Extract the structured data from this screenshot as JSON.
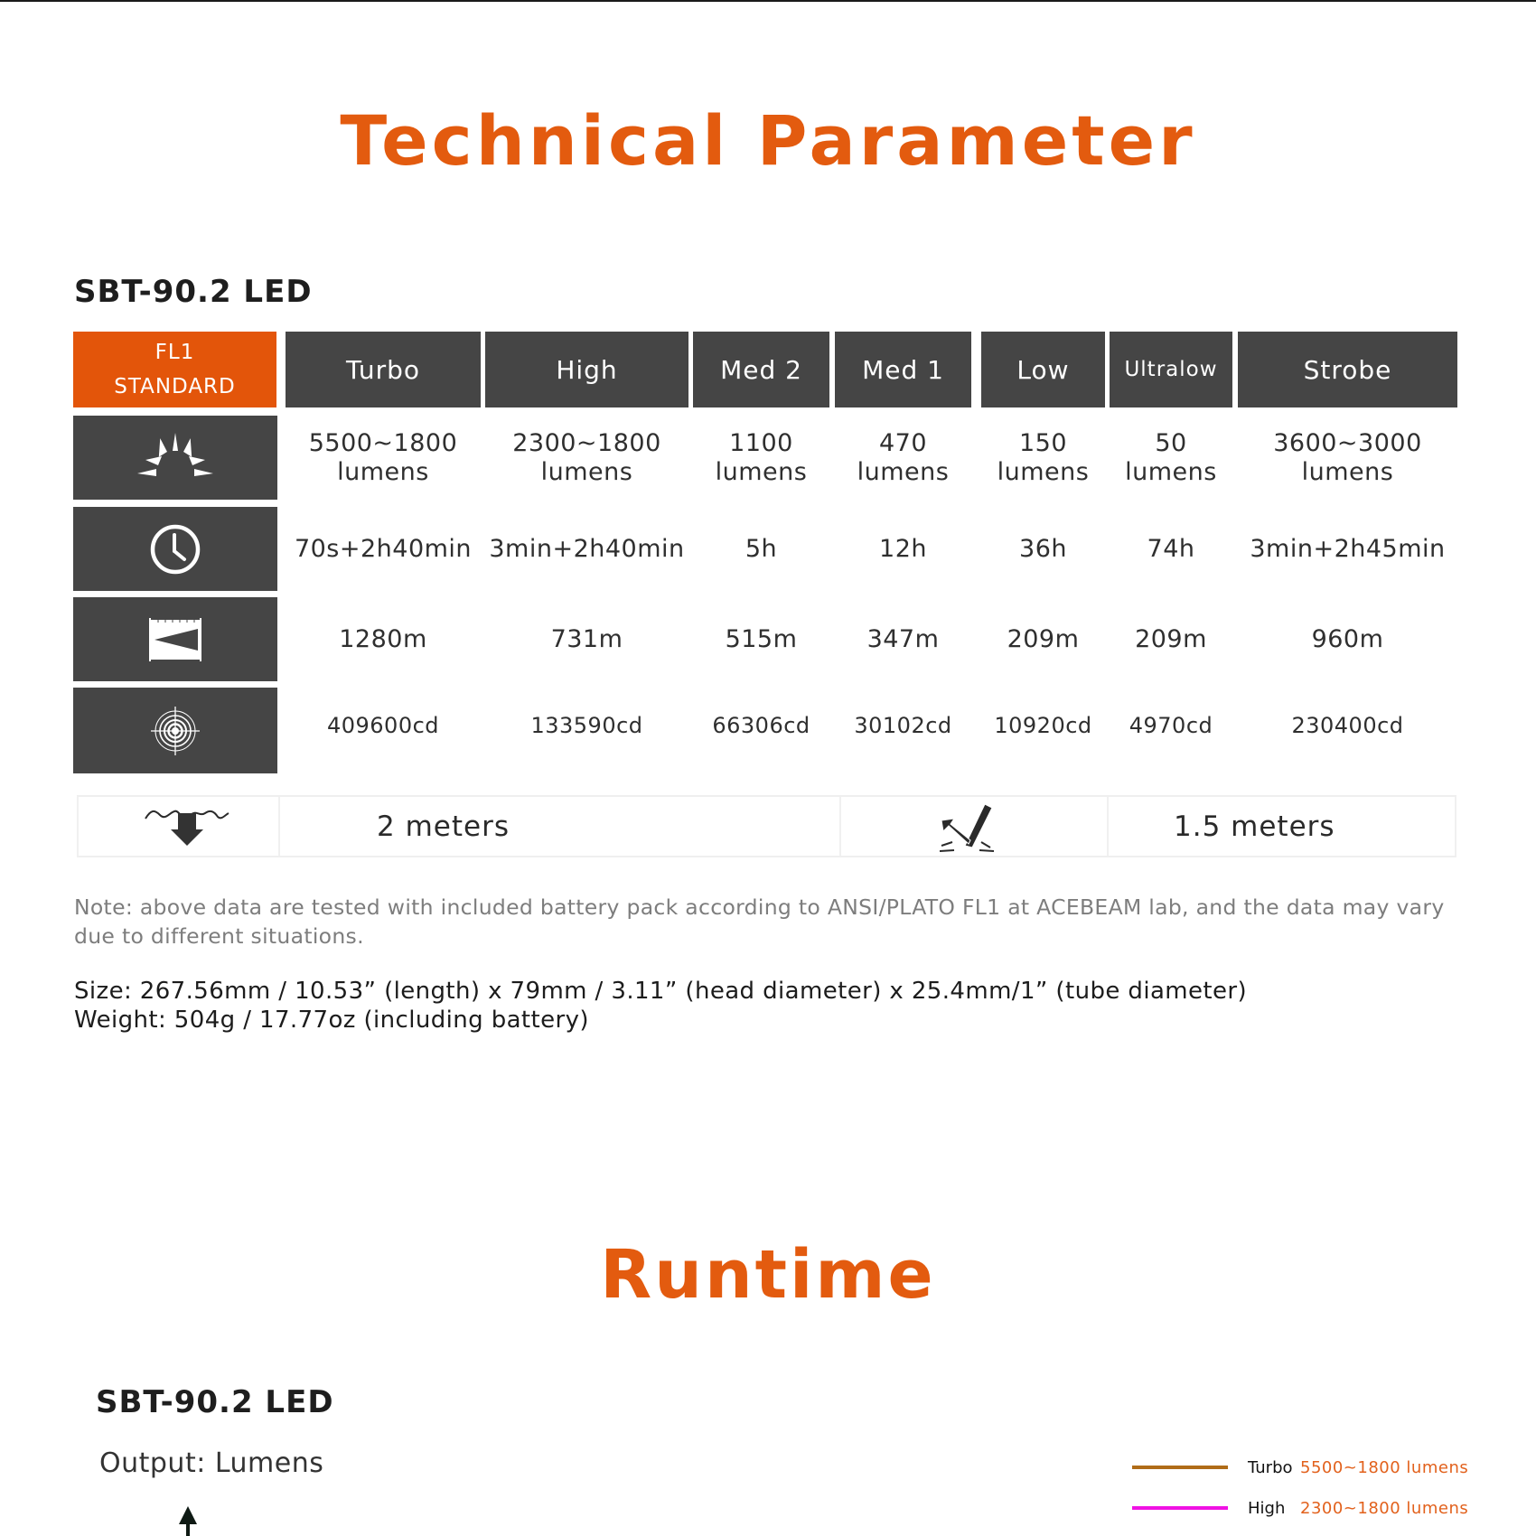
{
  "page": {
    "title": "Technical Parameter",
    "led_model": "SBT-90.2 LED"
  },
  "table": {
    "standard_label_line1": "FL1",
    "standard_label_line2": "STANDARD",
    "modes": [
      {
        "name": "Turbo",
        "output": "5500~1800",
        "output_unit": "lumens",
        "runtime": "70s+2h40min",
        "distance": "1280m",
        "intensity": "409600cd"
      },
      {
        "name": "High",
        "output": "2300~1800",
        "output_unit": "lumens",
        "runtime": "3min+2h40min",
        "distance": "731m",
        "intensity": "133590cd"
      },
      {
        "name": "Med 2",
        "output": "1100",
        "output_unit": "lumens",
        "runtime": "5h",
        "distance": "515m",
        "intensity": "66306cd"
      },
      {
        "name": "Med 1",
        "output": "470",
        "output_unit": "lumens",
        "runtime": "12h",
        "distance": "347m",
        "intensity": "30102cd"
      },
      {
        "name": "Low",
        "output": "150",
        "output_unit": "lumens",
        "runtime": "36h",
        "distance": "209m",
        "intensity": "10920cd"
      },
      {
        "name": "Ultralow",
        "output": "50",
        "output_unit": "lumens",
        "runtime": "74h",
        "distance": "209m",
        "intensity": "4970cd"
      },
      {
        "name": "Strobe",
        "output": "3600~3000",
        "output_unit": "lumens",
        "runtime": "3min+2h45min",
        "distance": "960m",
        "intensity": "230400cd"
      }
    ],
    "row_icons": [
      "light-output-icon",
      "clock-icon",
      "beam-distance-icon",
      "intensity-target-icon"
    ]
  },
  "specs_row": {
    "waterproof_icon": "underwater-arrow-icon",
    "waterproof_value": "2 meters",
    "impact_icon": "impact-resistance-icon",
    "impact_value": "1.5 meters"
  },
  "note": "Note: above data are tested with included battery pack according to ANSI/PLATO FL1 at ACEBEAM lab, and the data may vary due to different situations.",
  "size": "Size: 267.56mm / 10.53” (length) x 79mm / 3.11” (head diameter) x 25.4mm/1” (tube diameter)",
  "weight": "Weight: 504g / 17.77oz (including battery)",
  "runtime": {
    "title": "Runtime",
    "led_model": "SBT-90.2 LED",
    "output_label": "Output: Lumens",
    "legend": [
      {
        "name": "Turbo",
        "value": "5500~1800 lumens",
        "color": "#b06c18"
      },
      {
        "name": "High",
        "value": "2300~1800 lumens",
        "color": "#f012e4"
      }
    ]
  },
  "colors": {
    "accent": "#e35b0f",
    "header_bg": "#454545"
  }
}
